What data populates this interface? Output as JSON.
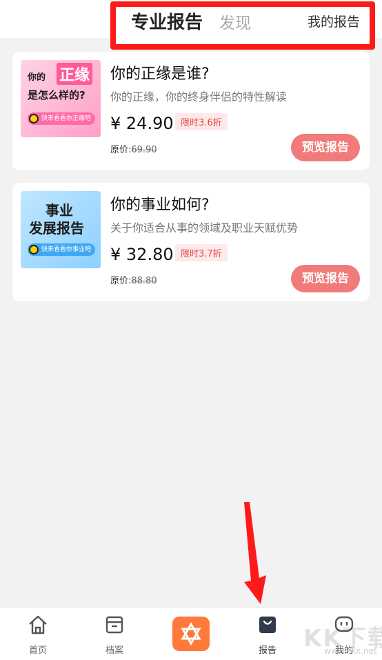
{
  "header": {
    "tabs": [
      {
        "label": "专业报告",
        "active": true
      },
      {
        "label": "发现",
        "active": false
      },
      {
        "label": "我的报告",
        "active": false
      }
    ],
    "highlight_color": "#ff1a1a"
  },
  "cards": [
    {
      "thumb": {
        "line1": "你的",
        "line1b": "正缘",
        "line2": "是怎么样的?",
        "pill": "快来看看你正缘吧"
      },
      "title": "你的正缘是谁?",
      "desc": "你的正缘，你的终身伴侣的特性解读",
      "price": "¥ 24.90",
      "discount": "限时3.6折",
      "orig_label": "原价:",
      "orig_price": "69.90",
      "button": "预览报告"
    },
    {
      "thumb": {
        "line1": "事业",
        "line2": "发展报告",
        "pill": "快来看看你事业吧"
      },
      "title": "你的事业如何?",
      "desc": "关于你适合从事的领域及职业天赋优势",
      "price": "¥ 32.80",
      "discount": "限时3.7折",
      "orig_label": "原价:",
      "orig_price": "88.80",
      "button": "预览报告"
    }
  ],
  "bottom_nav": [
    {
      "label": "首页",
      "icon": "home-icon"
    },
    {
      "label": "档案",
      "icon": "archive-icon"
    },
    {
      "label": "",
      "icon": "star-of-david-icon"
    },
    {
      "label": "报告",
      "icon": "bag-icon",
      "active": true
    },
    {
      "label": "我的",
      "icon": "chat-face-icon"
    }
  ],
  "watermark": {
    "main": "KK下载",
    "sub": "www.kkx.net"
  },
  "colors": {
    "accent": "#ff7a3a",
    "button": "#f17a7a",
    "discount_text": "#e54848",
    "annotation": "#ff1a1a"
  }
}
